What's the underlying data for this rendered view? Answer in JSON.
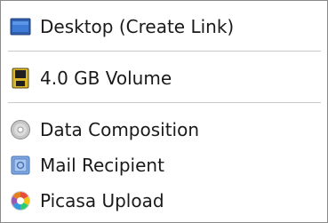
{
  "menu": {
    "items": [
      {
        "label": "Desktop (Create Link)",
        "icon": "desktop-icon"
      },
      {
        "label": "4.0 GB Volume",
        "icon": "volume-drive-icon"
      },
      {
        "label": "Data Composition",
        "icon": "disc-icon"
      },
      {
        "label": "Mail Recipient",
        "icon": "mail-icon"
      },
      {
        "label": "Picasa Upload",
        "icon": "picasa-icon"
      }
    ]
  }
}
